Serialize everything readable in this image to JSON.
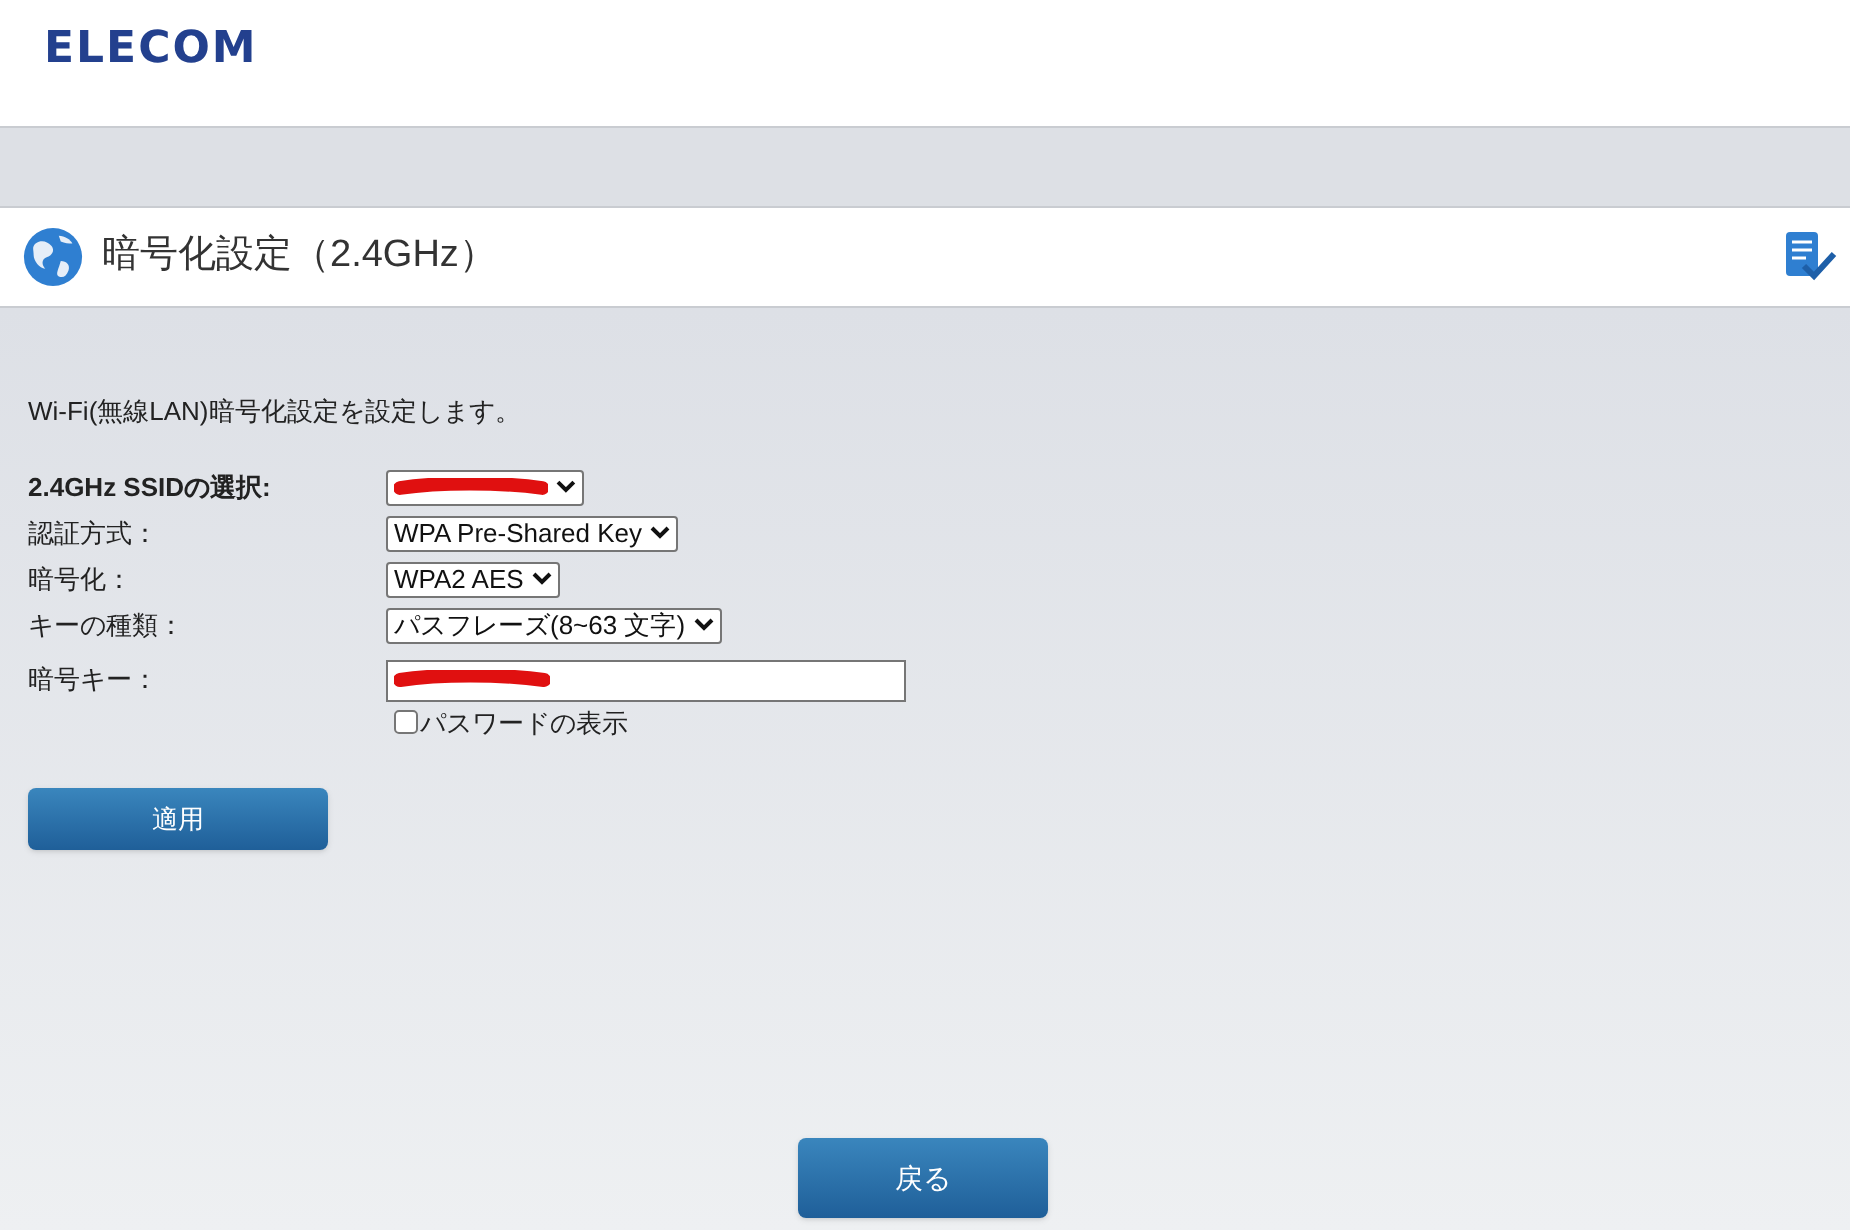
{
  "header": {
    "logo": "ELECOM"
  },
  "title_bar": {
    "title": "暗号化設定（2.4GHz）"
  },
  "description": "Wi-Fi(無線LAN)暗号化設定を設定します。",
  "form": [
    {
      "label": "2.4GHz SSIDの選択:",
      "bold": true,
      "kind": "select",
      "redacted": true
    },
    {
      "label": "認証方式：",
      "bold": false,
      "kind": "select",
      "value": "WPA Pre-Shared Key"
    },
    {
      "label": "暗号化：",
      "bold": false,
      "kind": "select",
      "value": "WPA2 AES"
    },
    {
      "label": "キーの種類：",
      "bold": false,
      "kind": "select",
      "value": "パスフレーズ(8~63 文字)"
    },
    {
      "label": "暗号キー：",
      "bold": false,
      "kind": "text",
      "redacted": true
    }
  ],
  "show_password": {
    "label": "パスワードの表示",
    "checked": false
  },
  "apply_button": "適用",
  "back_button": "戻る"
}
